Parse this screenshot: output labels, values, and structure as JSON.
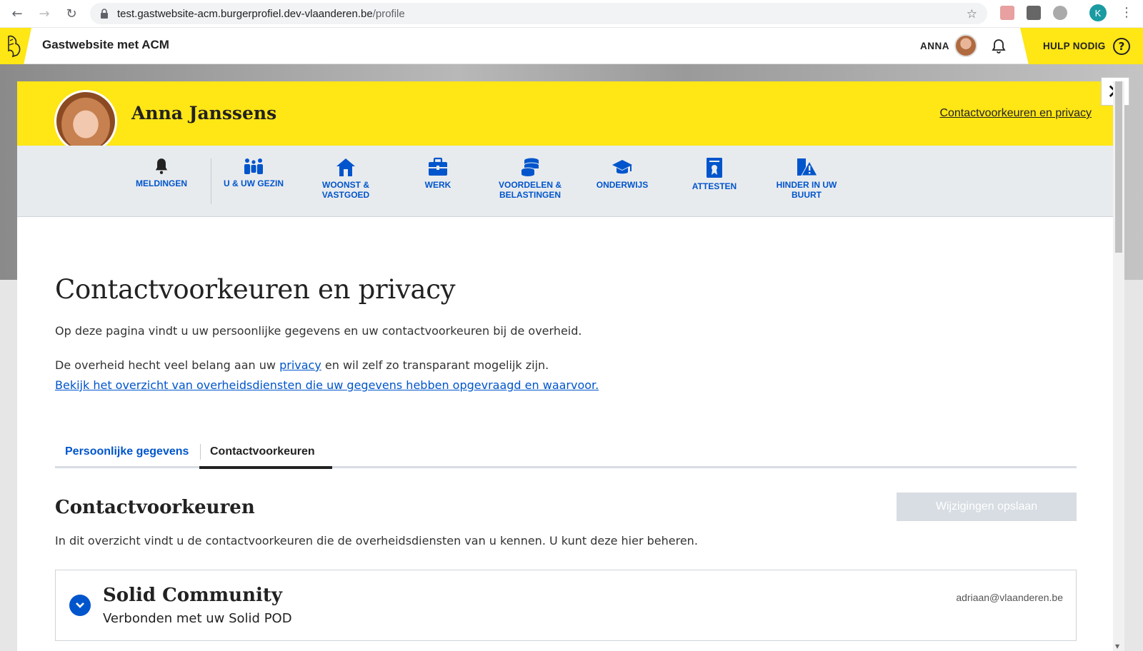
{
  "browser": {
    "url_host": "test.gastwebsite-acm.burgerprofiel.dev-vlaanderen.be",
    "url_path": "/profile",
    "profile_initial": "K"
  },
  "header": {
    "site_title": "Gastwebsite met ACM",
    "user_name": "ANNA",
    "help_label": "HULP NODIG",
    "help_symbol": "?",
    "accent_color": "#ffe615"
  },
  "profile": {
    "name": "Anna Janssens",
    "banner_link": "Contactvoorkeuren en privacy"
  },
  "nav": {
    "items": [
      {
        "label": "MELDINGEN",
        "icon": "bell-icon"
      },
      {
        "label": "U & UW GEZIN",
        "icon": "family-icon"
      },
      {
        "label": "WOONST & VASTGOED",
        "icon": "house-icon"
      },
      {
        "label": "WERK",
        "icon": "briefcase-icon"
      },
      {
        "label": "VOORDELEN & BELASTINGEN",
        "icon": "coins-icon"
      },
      {
        "label": "ONDERWIJS",
        "icon": "graduation-cap-icon"
      },
      {
        "label": "ATTESTEN",
        "icon": "certificate-icon"
      },
      {
        "label": "HINDER IN UW BUURT",
        "icon": "roadwork-icon"
      }
    ],
    "color": "#0055cc"
  },
  "main": {
    "title": "Contactvoorkeuren en privacy",
    "intro": "Op deze pagina vindt u uw persoonlijke gegevens en uw contactvoorkeuren bij de overheid.",
    "privacy_pre": "De overheid hecht veel belang aan uw ",
    "privacy_link": "privacy",
    "privacy_post": " en wil zelf zo transparant mogelijk zijn.",
    "overview_link": "Bekijk het overzicht van overheidsdiensten die uw gegevens hebben opgevraagd en waarvoor.",
    "tabs": [
      {
        "label": "Persoonlijke gegevens",
        "active": false
      },
      {
        "label": "Contactvoorkeuren",
        "active": true
      }
    ],
    "section_title": "Contactvoorkeuren",
    "save_label": "Wijzigingen opslaan",
    "section_desc": "In dit overzicht vindt u de contactvoorkeuren die de overheidsdiensten van u kennen. U kunt deze hier beheren.",
    "card": {
      "title": "Solid Community",
      "subtitle": "Verbonden met uw Solid POD",
      "email": "adriaan@vlaanderen.be"
    }
  }
}
